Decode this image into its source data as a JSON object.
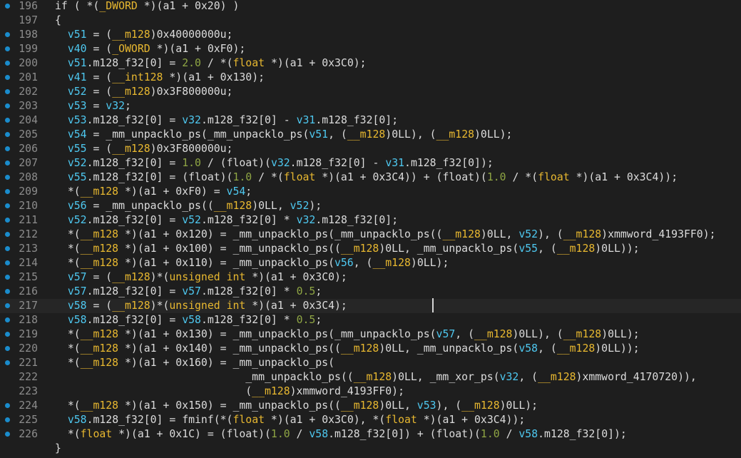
{
  "editor": {
    "lines": [
      {
        "n": "196",
        "bp": true,
        "tokens": [
          [
            "p",
            "if ( *("
          ],
          [
            "t",
            "_DWORD"
          ],
          [
            "p",
            " *)(a1 + 0x20) )"
          ]
        ]
      },
      {
        "n": "197",
        "bp": false,
        "tokens": [
          [
            "p",
            "{"
          ]
        ]
      },
      {
        "n": "198",
        "bp": true,
        "tokens": [
          [
            "p",
            "  "
          ],
          [
            "v",
            "v51"
          ],
          [
            "p",
            " = ("
          ],
          [
            "t",
            "__m128"
          ],
          [
            "p",
            ")0x40000000u;"
          ]
        ]
      },
      {
        "n": "199",
        "bp": true,
        "tokens": [
          [
            "p",
            "  "
          ],
          [
            "v",
            "v40"
          ],
          [
            "p",
            " = ("
          ],
          [
            "t",
            "_OWORD"
          ],
          [
            "p",
            " *)(a1 + 0xF0);"
          ]
        ]
      },
      {
        "n": "200",
        "bp": true,
        "tokens": [
          [
            "p",
            "  "
          ],
          [
            "v",
            "v51"
          ],
          [
            "p",
            ".m128_f32[0] = "
          ],
          [
            "n",
            "2.0"
          ],
          [
            "p",
            " / *("
          ],
          [
            "t",
            "float"
          ],
          [
            "p",
            " *)(a1 + 0x3C0);"
          ]
        ]
      },
      {
        "n": "201",
        "bp": true,
        "tokens": [
          [
            "p",
            "  "
          ],
          [
            "v",
            "v41"
          ],
          [
            "p",
            " = ("
          ],
          [
            "t",
            "__int128"
          ],
          [
            "p",
            " *)(a1 + 0x130);"
          ]
        ]
      },
      {
        "n": "202",
        "bp": true,
        "tokens": [
          [
            "p",
            "  "
          ],
          [
            "v",
            "v52"
          ],
          [
            "p",
            " = ("
          ],
          [
            "t",
            "__m128"
          ],
          [
            "p",
            ")0x3F800000u;"
          ]
        ]
      },
      {
        "n": "203",
        "bp": true,
        "tokens": [
          [
            "p",
            "  "
          ],
          [
            "v",
            "v53"
          ],
          [
            "p",
            " = "
          ],
          [
            "v",
            "v32"
          ],
          [
            "p",
            ";"
          ]
        ]
      },
      {
        "n": "204",
        "bp": true,
        "tokens": [
          [
            "p",
            "  "
          ],
          [
            "v",
            "v53"
          ],
          [
            "p",
            ".m128_f32[0] = "
          ],
          [
            "v",
            "v32"
          ],
          [
            "p",
            ".m128_f32[0] - "
          ],
          [
            "v",
            "v31"
          ],
          [
            "p",
            ".m128_f32[0];"
          ]
        ]
      },
      {
        "n": "205",
        "bp": true,
        "tokens": [
          [
            "p",
            "  "
          ],
          [
            "v",
            "v54"
          ],
          [
            "p",
            " = _mm_unpacklo_ps(_mm_unpacklo_ps("
          ],
          [
            "v",
            "v51"
          ],
          [
            "p",
            ", ("
          ],
          [
            "t",
            "__m128"
          ],
          [
            "p",
            ")0LL), ("
          ],
          [
            "t",
            "__m128"
          ],
          [
            "p",
            ")0LL);"
          ]
        ]
      },
      {
        "n": "206",
        "bp": true,
        "tokens": [
          [
            "p",
            "  "
          ],
          [
            "v",
            "v55"
          ],
          [
            "p",
            " = ("
          ],
          [
            "t",
            "__m128"
          ],
          [
            "p",
            ")0x3F800000u;"
          ]
        ]
      },
      {
        "n": "207",
        "bp": true,
        "tokens": [
          [
            "p",
            "  "
          ],
          [
            "v",
            "v52"
          ],
          [
            "p",
            ".m128_f32[0] = "
          ],
          [
            "n",
            "1.0"
          ],
          [
            "p",
            " / (float)("
          ],
          [
            "v",
            "v32"
          ],
          [
            "p",
            ".m128_f32[0] - "
          ],
          [
            "v",
            "v31"
          ],
          [
            "p",
            ".m128_f32[0]);"
          ]
        ]
      },
      {
        "n": "208",
        "bp": true,
        "tokens": [
          [
            "p",
            "  "
          ],
          [
            "v",
            "v55"
          ],
          [
            "p",
            ".m128_f32[0] = (float)("
          ],
          [
            "n",
            "1.0"
          ],
          [
            "p",
            " / *("
          ],
          [
            "t",
            "float"
          ],
          [
            "p",
            " *)(a1 + 0x3C4)) + (float)("
          ],
          [
            "n",
            "1.0"
          ],
          [
            "p",
            " / *("
          ],
          [
            "t",
            "float"
          ],
          [
            "p",
            " *)(a1 + 0x3C4));"
          ]
        ]
      },
      {
        "n": "209",
        "bp": true,
        "tokens": [
          [
            "p",
            "  *("
          ],
          [
            "t",
            "__m128"
          ],
          [
            "p",
            " *)(a1 + 0xF0) = "
          ],
          [
            "v",
            "v54"
          ],
          [
            "p",
            ";"
          ]
        ]
      },
      {
        "n": "210",
        "bp": true,
        "tokens": [
          [
            "p",
            "  "
          ],
          [
            "v",
            "v56"
          ],
          [
            "p",
            " = _mm_unpacklo_ps(("
          ],
          [
            "t",
            "__m128"
          ],
          [
            "p",
            ")0LL, "
          ],
          [
            "v",
            "v52"
          ],
          [
            "p",
            ");"
          ]
        ]
      },
      {
        "n": "211",
        "bp": true,
        "tokens": [
          [
            "p",
            "  "
          ],
          [
            "v",
            "v52"
          ],
          [
            "p",
            ".m128_f32[0] = "
          ],
          [
            "v",
            "v52"
          ],
          [
            "p",
            ".m128_f32[0] * "
          ],
          [
            "v",
            "v32"
          ],
          [
            "p",
            ".m128_f32[0];"
          ]
        ]
      },
      {
        "n": "212",
        "bp": true,
        "tokens": [
          [
            "p",
            "  *("
          ],
          [
            "t",
            "__m128"
          ],
          [
            "p",
            " *)(a1 + 0x120) = _mm_unpacklo_ps(_mm_unpacklo_ps(("
          ],
          [
            "t",
            "__m128"
          ],
          [
            "p",
            ")0LL, "
          ],
          [
            "v",
            "v52"
          ],
          [
            "p",
            "), ("
          ],
          [
            "t",
            "__m128"
          ],
          [
            "p",
            ")xmmword_4193FF0);"
          ]
        ]
      },
      {
        "n": "213",
        "bp": true,
        "tokens": [
          [
            "p",
            "  *("
          ],
          [
            "t",
            "__m128"
          ],
          [
            "p",
            " *)(a1 + 0x100) = _mm_unpacklo_ps(("
          ],
          [
            "t",
            "__m128"
          ],
          [
            "p",
            ")0LL, _mm_unpacklo_ps("
          ],
          [
            "v",
            "v55"
          ],
          [
            "p",
            ", ("
          ],
          [
            "t",
            "__m128"
          ],
          [
            "p",
            ")0LL));"
          ]
        ]
      },
      {
        "n": "214",
        "bp": true,
        "tokens": [
          [
            "p",
            "  *("
          ],
          [
            "t",
            "__m128"
          ],
          [
            "p",
            " *)(a1 + 0x110) = _mm_unpacklo_ps("
          ],
          [
            "v",
            "v56"
          ],
          [
            "p",
            ", ("
          ],
          [
            "t",
            "__m128"
          ],
          [
            "p",
            ")0LL);"
          ]
        ]
      },
      {
        "n": "215",
        "bp": true,
        "tokens": [
          [
            "p",
            "  "
          ],
          [
            "v",
            "v57"
          ],
          [
            "p",
            " = ("
          ],
          [
            "t",
            "__m128"
          ],
          [
            "p",
            ")*("
          ],
          [
            "t",
            "unsigned int"
          ],
          [
            "p",
            " *)(a1 + 0x3C0);"
          ]
        ]
      },
      {
        "n": "216",
        "bp": true,
        "tokens": [
          [
            "p",
            "  "
          ],
          [
            "v",
            "v57"
          ],
          [
            "p",
            ".m128_f32[0] = "
          ],
          [
            "v",
            "v57"
          ],
          [
            "p",
            ".m128_f32[0] * "
          ],
          [
            "n",
            "0.5"
          ],
          [
            "p",
            ";"
          ]
        ]
      },
      {
        "n": "217",
        "bp": true,
        "tokens": [
          [
            "p",
            "  "
          ],
          [
            "v",
            "v58"
          ],
          [
            "p",
            " = ("
          ],
          [
            "t",
            "__m128"
          ],
          [
            "p",
            ")*("
          ],
          [
            "t",
            "unsigned int"
          ],
          [
            "p",
            " *)(a1 + 0x3C4);"
          ]
        ]
      },
      {
        "n": "218",
        "bp": true,
        "tokens": [
          [
            "p",
            "  "
          ],
          [
            "v",
            "v58"
          ],
          [
            "p",
            ".m128_f32[0] = "
          ],
          [
            "v",
            "v58"
          ],
          [
            "p",
            ".m128_f32[0] * "
          ],
          [
            "n",
            "0.5"
          ],
          [
            "p",
            ";"
          ]
        ]
      },
      {
        "n": "219",
        "bp": true,
        "tokens": [
          [
            "p",
            "  *("
          ],
          [
            "t",
            "__m128"
          ],
          [
            "p",
            " *)(a1 + 0x130) = _mm_unpacklo_ps(_mm_unpacklo_ps("
          ],
          [
            "v",
            "v57"
          ],
          [
            "p",
            ", ("
          ],
          [
            "t",
            "__m128"
          ],
          [
            "p",
            ")0LL), ("
          ],
          [
            "t",
            "__m128"
          ],
          [
            "p",
            ")0LL);"
          ]
        ]
      },
      {
        "n": "220",
        "bp": true,
        "tokens": [
          [
            "p",
            "  *("
          ],
          [
            "t",
            "__m128"
          ],
          [
            "p",
            " *)(a1 + 0x140) = _mm_unpacklo_ps(("
          ],
          [
            "t",
            "__m128"
          ],
          [
            "p",
            ")0LL, _mm_unpacklo_ps("
          ],
          [
            "v",
            "v58"
          ],
          [
            "p",
            ", ("
          ],
          [
            "t",
            "__m128"
          ],
          [
            "p",
            ")0LL));"
          ]
        ]
      },
      {
        "n": "221",
        "bp": true,
        "tokens": [
          [
            "p",
            "  *("
          ],
          [
            "t",
            "__m128"
          ],
          [
            "p",
            " *)(a1 + 0x160) = _mm_unpacklo_ps("
          ]
        ]
      },
      {
        "n": "222",
        "bp": false,
        "tokens": [
          [
            "p",
            "                              _mm_unpacklo_ps(("
          ],
          [
            "t",
            "__m128"
          ],
          [
            "p",
            ")0LL, _mm_xor_ps("
          ],
          [
            "v",
            "v32"
          ],
          [
            "p",
            ", ("
          ],
          [
            "t",
            "__m128"
          ],
          [
            "p",
            ")xmmword_4170720)),"
          ]
        ]
      },
      {
        "n": "223",
        "bp": false,
        "tokens": [
          [
            "p",
            "                              ("
          ],
          [
            "t",
            "__m128"
          ],
          [
            "p",
            ")xmmword_4193FF0);"
          ]
        ]
      },
      {
        "n": "224",
        "bp": true,
        "tokens": [
          [
            "p",
            "  *("
          ],
          [
            "t",
            "__m128"
          ],
          [
            "p",
            " *)(a1 + 0x150) = _mm_unpacklo_ps(("
          ],
          [
            "t",
            "__m128"
          ],
          [
            "p",
            ")0LL, "
          ],
          [
            "v",
            "v53"
          ],
          [
            "p",
            "), ("
          ],
          [
            "t",
            "__m128"
          ],
          [
            "p",
            ")0LL);"
          ]
        ]
      },
      {
        "n": "225",
        "bp": true,
        "tokens": [
          [
            "p",
            "  "
          ],
          [
            "v",
            "v58"
          ],
          [
            "p",
            ".m128_f32[0] = fminf(*("
          ],
          [
            "t",
            "float"
          ],
          [
            "p",
            " *)(a1 + 0x3C0), *("
          ],
          [
            "t",
            "float"
          ],
          [
            "p",
            " *)(a1 + 0x3C4));"
          ]
        ]
      },
      {
        "n": "226",
        "bp": true,
        "tokens": [
          [
            "p",
            "  *("
          ],
          [
            "t",
            "float"
          ],
          [
            "p",
            " *)(a1 + 0x1C) = (float)("
          ],
          [
            "n",
            "1.0"
          ],
          [
            "p",
            " / "
          ],
          [
            "v",
            "v58"
          ],
          [
            "p",
            ".m128_f32[0]) + (float)("
          ],
          [
            "n",
            "1.0"
          ],
          [
            "p",
            " / "
          ],
          [
            "v",
            "v58"
          ],
          [
            "p",
            ".m128_f32[0]);"
          ]
        ]
      },
      {
        "n": "",
        "bp": false,
        "tokens": [
          [
            "p",
            "}"
          ]
        ]
      }
    ],
    "current_line": "217"
  }
}
